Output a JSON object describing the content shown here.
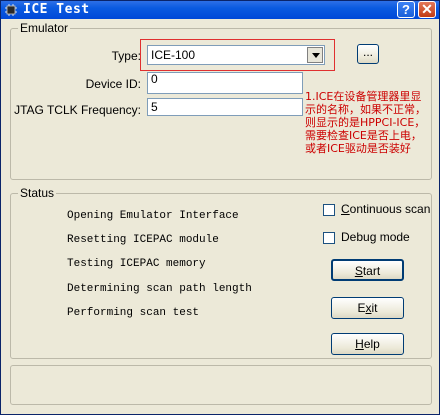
{
  "window": {
    "title": "ICE Test",
    "help_glyph": "?",
    "close_glyph": "✕"
  },
  "emulator": {
    "group_label": "Emulator",
    "type_label": "Type:",
    "type_value": "ICE-100",
    "browse_label": "...",
    "device_id_label": "Device ID:",
    "device_id_value": "0",
    "jtag_label": "JTAG TCLK Frequency:",
    "jtag_value": "5"
  },
  "annotation": {
    "lines": [
      "1.ICE在设备管理器里显",
      "示的名称，如果不正常，",
      "则显示的是HPPCI-ICE，",
      "需要检查ICE是否上电，",
      "或者ICE驱动是否装好"
    ],
    "color": "#cc0000"
  },
  "status": {
    "group_label": "Status",
    "lines": [
      "Opening Emulator Interface",
      "Resetting ICEPAC module",
      "Testing ICEPAC memory",
      "Determining scan path length",
      "Performing scan test"
    ]
  },
  "options": {
    "continuous_scan": {
      "accel": "C",
      "rest": "ontinuous scan",
      "checked": false
    },
    "debug_mode": {
      "pre": "Debug mode",
      "checked": false
    }
  },
  "buttons": {
    "start": {
      "accel": "S",
      "rest": "tart"
    },
    "exit": {
      "pre": "E",
      "accel": "x",
      "rest": "it"
    },
    "help": {
      "accel": "H",
      "rest": "elp"
    }
  },
  "icons": {
    "app": "chip-icon",
    "help": "help-icon",
    "close": "close-icon",
    "dropdown": "chevron-down-icon"
  }
}
